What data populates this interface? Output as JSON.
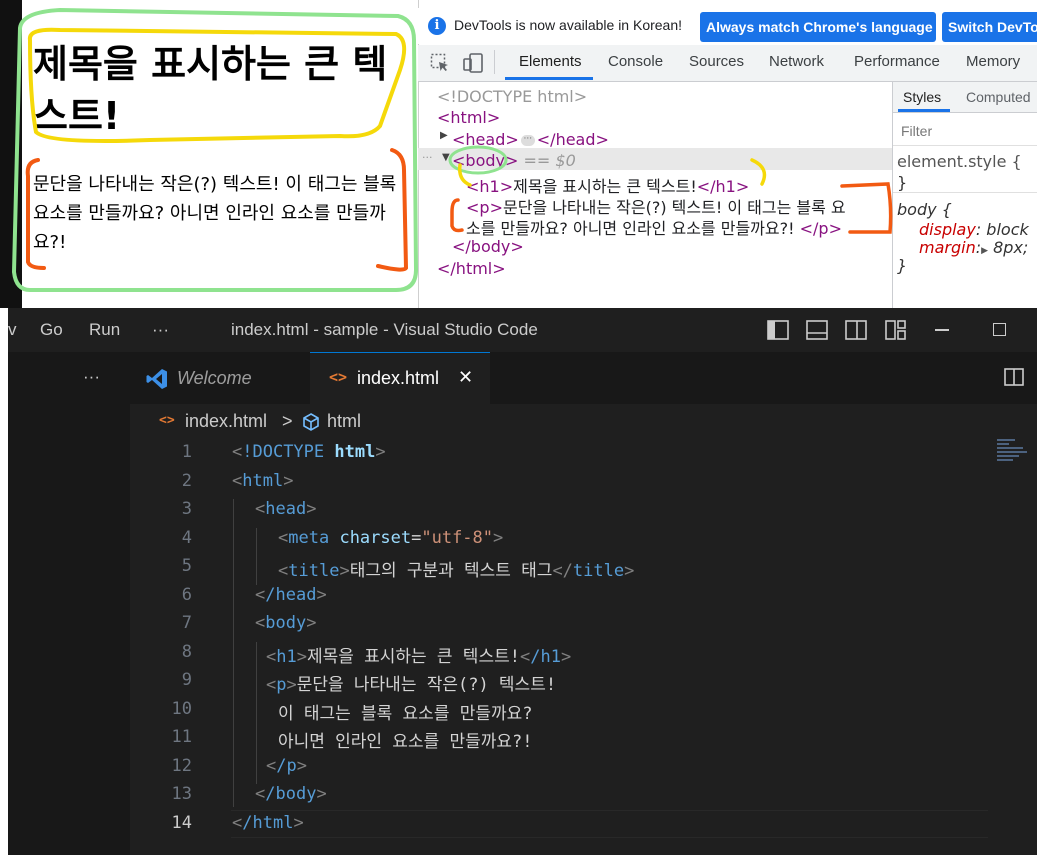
{
  "page": {
    "h1": "제목을 표시하는 큰 텍스트!",
    "p": "문단을 나타내는 작은(?) 텍스트! 이 태그는 블록 요소를 만들까요? 아니면 인라인 요소를 만들까요?!"
  },
  "devtools": {
    "info_text": "DevTools is now available in Korean!",
    "btn_match": "Always match Chrome's language",
    "btn_switch": "Switch DevTo",
    "tabs": [
      "Elements",
      "Console",
      "Sources",
      "Network",
      "Performance",
      "Memory"
    ],
    "dom": {
      "doctype": "<!DOCTYPE html>",
      "html_open": "<html>",
      "head": "<head>",
      "head_close": "</head>",
      "body": "<body>",
      "eq": "== $0",
      "h1_open": "<h1>",
      "h1_text": "제목을 표시하는 큰 텍스트!",
      "h1_close": "</h1>",
      "p_open": "<p>",
      "p_text1": "문단을 나타내는 작은(?) 텍스트! 이 태그는 블록 요",
      "p_text2": "소를 만들까요? 아니면 인라인 요소를 만들까요?!",
      "p_close": "</p>",
      "body_close": "</body>",
      "html_close": "</html>"
    },
    "styles": {
      "tabs": [
        "Styles",
        "Computed"
      ],
      "filter_placeholder": "Filter",
      "element_style": "element.style {",
      "close": "}",
      "body_sel": "body {",
      "display_prop": "display",
      "display_val": "block",
      "margin_prop": "margin",
      "margin_val": "8px;"
    }
  },
  "vscode": {
    "menu": [
      "v",
      "Go",
      "Run",
      "···"
    ],
    "title": "index.html - sample - Visual Studio Code",
    "tabs": {
      "more": "···",
      "welcome": "Welcome",
      "index": "index.html",
      "close": "✕"
    },
    "breadcrumb": {
      "file": "index.html",
      "sep": ">",
      "node": "html"
    },
    "line_numbers": [
      "1",
      "2",
      "3",
      "4",
      "5",
      "6",
      "7",
      "8",
      "9",
      "10",
      "11",
      "12",
      "13",
      "14"
    ],
    "code": {
      "l1_doctype": "!DOCTYPE",
      "l1_html": "html",
      "l2": "html",
      "l3": "head",
      "l4_tag": "meta",
      "l4_attr": "charset",
      "l4_val": "\"utf-8\"",
      "l5_tag": "title",
      "l5_text": "태그의 구분과 텍스트 태그",
      "l6": "/head",
      "l7": "body",
      "l8_tag": "h1",
      "l8_text": "제목을 표시하는 큰 텍스트!",
      "l8_close": "/h1",
      "l9_tag": "p",
      "l9_text": "문단을 나타내는 작은(?) 텍스트!",
      "l10_text": "이 태그는 블록 요소를 만들까요?",
      "l11_text": "아니면 인라인 요소를 만들까요?!",
      "l12": "/p",
      "l13": "/body",
      "l14": "/html"
    }
  },
  "colors": {
    "annotation_green": "#8fe38f",
    "annotation_yellow": "#f5d90a",
    "annotation_orange": "#f25a12",
    "vscode_bg": "#1f1f1f",
    "chrome_blue": "#1a73e8"
  }
}
